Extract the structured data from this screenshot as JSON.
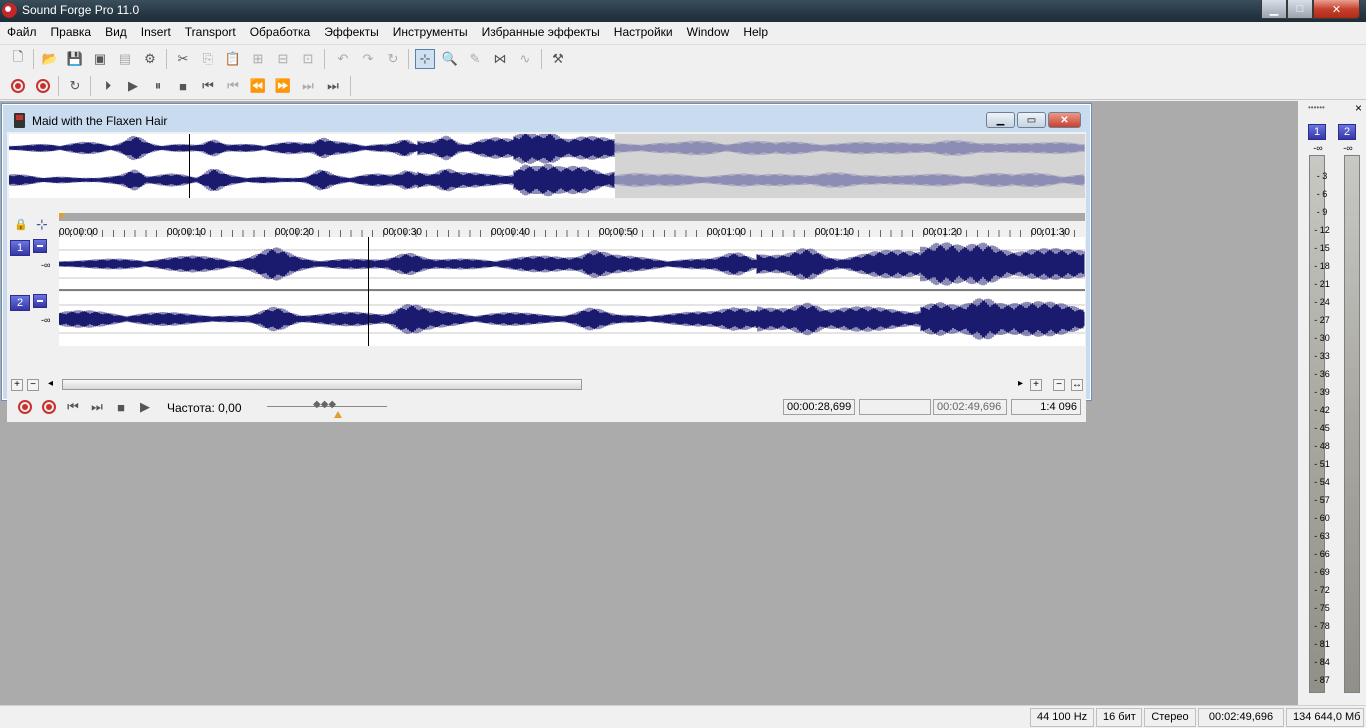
{
  "app": {
    "title": "Sound Forge Pro 11.0"
  },
  "menu": [
    "Файл",
    "Правка",
    "Вид",
    "Insert",
    "Transport",
    "Обработка",
    "Эффекты",
    "Инструменты",
    "Избранные эффекты",
    "Настройки",
    "Window",
    "Help"
  ],
  "document": {
    "title": "Maid with the Flaxen Hair",
    "ruler_ticks": [
      "00:00:00",
      "00:00:10",
      "00:00:20",
      "00:00:30",
      "00:00:40",
      "00:00:50",
      "00:01:00",
      "00:01:10",
      "00:01:20",
      "00:01:30"
    ],
    "channels": [
      {
        "label": "1",
        "level": "-∞"
      },
      {
        "label": "2",
        "level": "-∞"
      }
    ],
    "rate_label": "Частота: 0,00",
    "cursor_position": "00:00:28,699",
    "selection": "",
    "length": "00:02:49,696",
    "zoom": "1:4 096"
  },
  "meter": {
    "grip": "••••••",
    "close": "×",
    "channels": [
      "1",
      "2"
    ],
    "top": "-∞",
    "scale": [
      "3",
      "6",
      "9",
      "12",
      "15",
      "18",
      "21",
      "24",
      "27",
      "30",
      "33",
      "36",
      "39",
      "42",
      "45",
      "48",
      "51",
      "54",
      "57",
      "60",
      "63",
      "66",
      "69",
      "72",
      "75",
      "78",
      "81",
      "84",
      "87"
    ]
  },
  "status": {
    "sample_rate": "44 100 Hz",
    "bit_depth": "16 бит",
    "channels": "Стерео",
    "length": "00:02:49,696",
    "free_space": "134 644,0 Мб"
  },
  "colors": {
    "waveform": "#1a1a6e",
    "channel_button": "#3436a8",
    "record": "#c8322e"
  }
}
